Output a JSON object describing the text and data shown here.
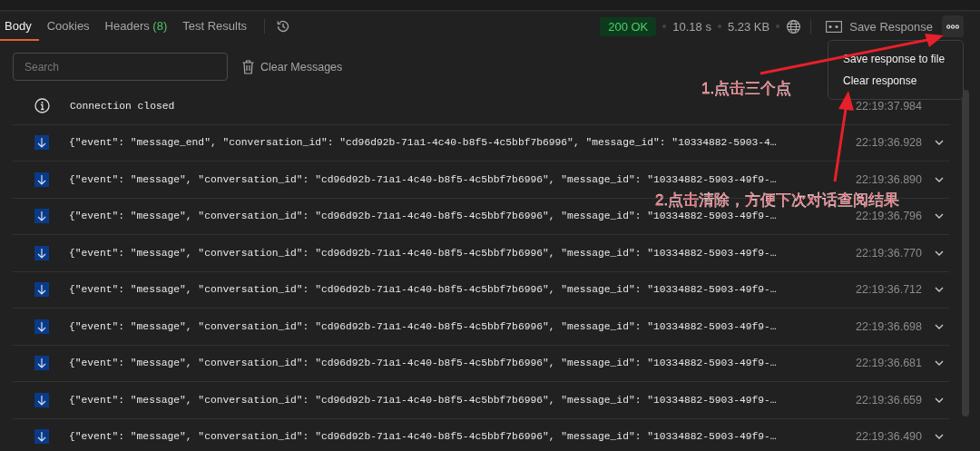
{
  "tabs": [
    {
      "label": "Body",
      "selected": true
    },
    {
      "label": "Cookies",
      "selected": false
    },
    {
      "label": "Headers",
      "count": "(8)",
      "selected": false
    },
    {
      "label": "Test Results",
      "selected": false
    }
  ],
  "status": {
    "code": "200 OK",
    "time": "10.18 s",
    "size": "5.23 KB"
  },
  "save_button": "Save Response",
  "menu": {
    "items": [
      "Save response to file",
      "Clear response"
    ]
  },
  "search": {
    "placeholder": "Search"
  },
  "clear_button": "Clear Messages",
  "messages": [
    {
      "kind": "info",
      "text": "Connection closed",
      "time": "22:19:37.984"
    },
    {
      "kind": "incoming",
      "text": "{\"event\": \"message_end\", \"conversation_id\": \"cd96d92b-71a1-4c40-b8f5-4c5bbf7b6996\", \"message_id\": \"10334882-5903-4…",
      "time": "22:19:36.928"
    },
    {
      "kind": "incoming",
      "text": "{\"event\": \"message\", \"conversation_id\": \"cd96d92b-71a1-4c40-b8f5-4c5bbf7b6996\", \"message_id\": \"10334882-5903-49f9-…",
      "time": "22:19:36.890"
    },
    {
      "kind": "incoming",
      "text": "{\"event\": \"message\", \"conversation_id\": \"cd96d92b-71a1-4c40-b8f5-4c5bbf7b6996\", \"message_id\": \"10334882-5903-49f9-…",
      "time": "22:19:36.796"
    },
    {
      "kind": "incoming",
      "text": "{\"event\": \"message\", \"conversation_id\": \"cd96d92b-71a1-4c40-b8f5-4c5bbf7b6996\", \"message_id\": \"10334882-5903-49f9-…",
      "time": "22:19:36.770"
    },
    {
      "kind": "incoming",
      "text": "{\"event\": \"message\", \"conversation_id\": \"cd96d92b-71a1-4c40-b8f5-4c5bbf7b6996\", \"message_id\": \"10334882-5903-49f9-…",
      "time": "22:19:36.712"
    },
    {
      "kind": "incoming",
      "text": "{\"event\": \"message\", \"conversation_id\": \"cd96d92b-71a1-4c40-b8f5-4c5bbf7b6996\", \"message_id\": \"10334882-5903-49f9-…",
      "time": "22:19:36.698"
    },
    {
      "kind": "incoming",
      "text": "{\"event\": \"message\", \"conversation_id\": \"cd96d92b-71a1-4c40-b8f5-4c5bbf7b6996\", \"message_id\": \"10334882-5903-49f9-…",
      "time": "22:19:36.681"
    },
    {
      "kind": "incoming",
      "text": "{\"event\": \"message\", \"conversation_id\": \"cd96d92b-71a1-4c40-b8f5-4c5bbf7b6996\", \"message_id\": \"10334882-5903-49f9-…",
      "time": "22:19:36.659"
    },
    {
      "kind": "incoming",
      "text": "{\"event\": \"message\", \"conversation_id\": \"cd96d92b-71a1-4c40-b8f5-4c5bbf7b6996\", \"message_id\": \"10334882-5903-49f9-…",
      "time": "22:19:36.490"
    }
  ],
  "annotations": [
    "1.点击三个点",
    "2.点击清除，方便下次对话查阅结果"
  ]
}
